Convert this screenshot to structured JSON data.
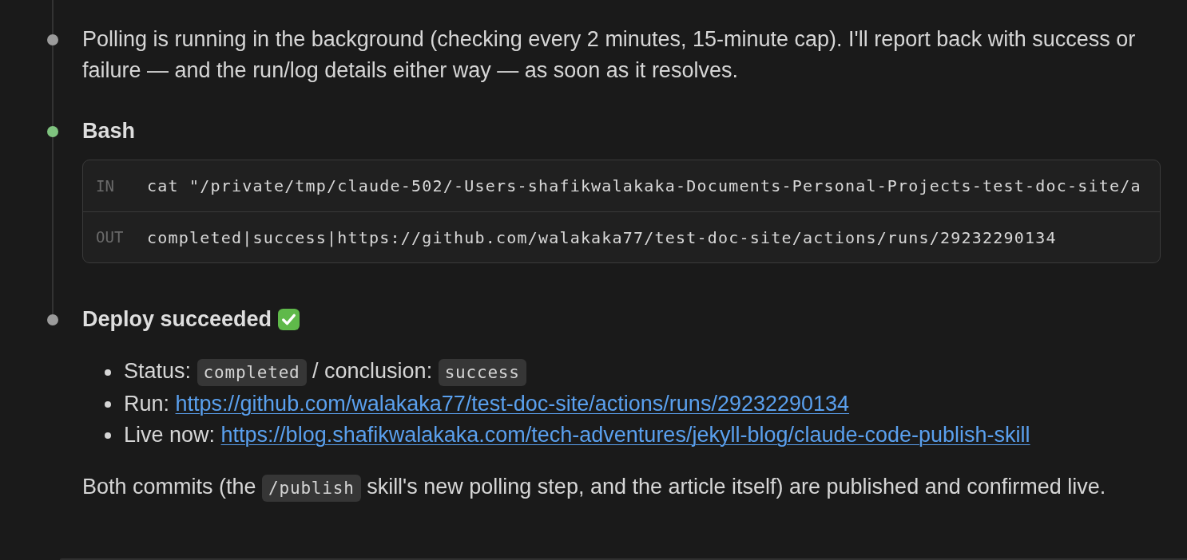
{
  "timeline": [
    {
      "kind": "message",
      "color": "#9b9b9b",
      "blocks": [
        {
          "kind": "paragraph",
          "parts": [
            {
              "kind": "text",
              "text": "Polling is running in the background (checking every 2 minutes, 15-minute cap). I'll report back with success or failure — and the run/log details either way — as soon as it resolves."
            }
          ]
        }
      ]
    },
    {
      "kind": "tool",
      "color": "#7fc37f",
      "title": "Bash",
      "io": [
        {
          "label": "IN",
          "text": "cat \"/private/tmp/claude-502/-Users-shafikwalakaka-Documents-Personal-Projects-test-doc-site/a"
        },
        {
          "label": "OUT",
          "text": "completed|success|https://github.com/walakaka77/test-doc-site/actions/runs/29232290134"
        }
      ]
    },
    {
      "kind": "message",
      "color": "#9b9b9b",
      "heading": {
        "text": "Deploy succeeded",
        "done": true
      },
      "blocks": [
        {
          "kind": "list",
          "items": [
            {
              "parts": [
                {
                  "kind": "text",
                  "text": "Status: "
                },
                {
                  "kind": "code",
                  "text": "completed"
                },
                {
                  "kind": "text",
                  "text": " / conclusion: "
                },
                {
                  "kind": "code",
                  "text": "success"
                }
              ]
            },
            {
              "parts": [
                {
                  "kind": "text",
                  "text": "Run: "
                },
                {
                  "kind": "link",
                  "text": "https://github.com/walakaka77/test-doc-site/actions/runs/29232290134"
                }
              ]
            },
            {
              "parts": [
                {
                  "kind": "text",
                  "text": "Live now: "
                },
                {
                  "kind": "link",
                  "text": "https://blog.shafikwalakaka.com/tech-adventures/jekyll-blog/claude-code-publish-skill"
                }
              ]
            }
          ]
        },
        {
          "kind": "paragraph",
          "parts": [
            {
              "kind": "text",
              "text": "Both commits (the "
            },
            {
              "kind": "code",
              "text": "/publish"
            },
            {
              "kind": "text",
              "text": " skill's new polling step, and the article itself) are published and confirmed live."
            }
          ]
        }
      ]
    }
  ]
}
